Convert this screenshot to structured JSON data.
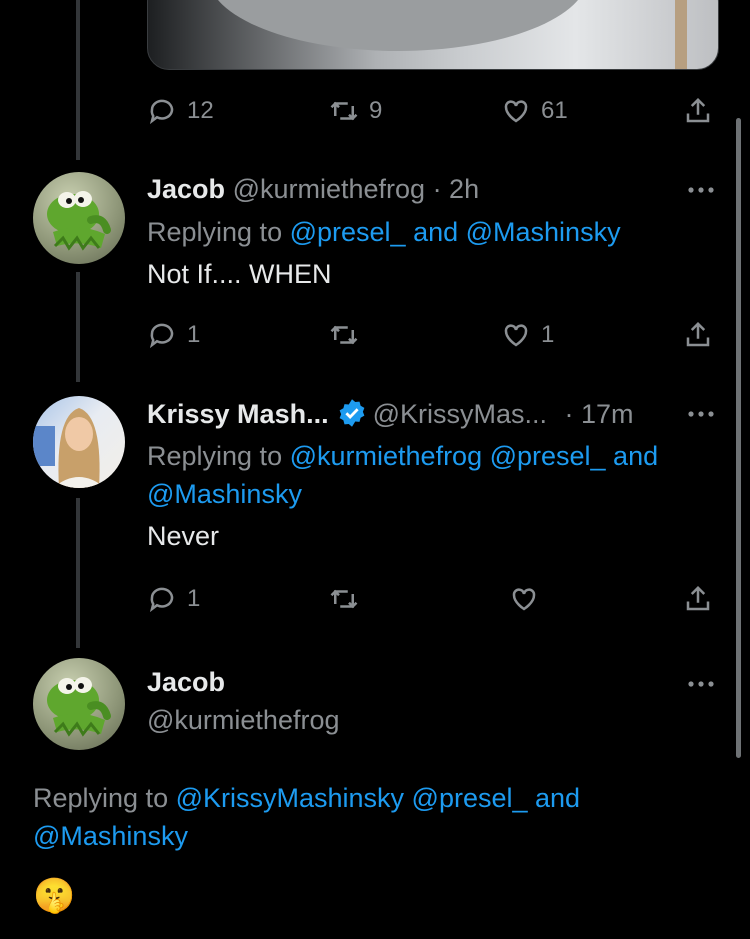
{
  "top_tweet": {
    "actions": {
      "replies": "12",
      "retweets": "9",
      "likes": "61"
    }
  },
  "reply1": {
    "name": "Jacob",
    "handle": "@kurmiethefrog",
    "time": "· 2h",
    "replying_prefix": "Replying to",
    "replying_mentions": "@presel_ and @Mashinsky",
    "text": "Not If.... WHEN",
    "actions": {
      "replies": "1",
      "likes": "1"
    }
  },
  "reply2": {
    "name": "Krissy Mash...",
    "handle": "@KrissyMas...",
    "time": "· 17m",
    "replying_prefix": "Replying to",
    "replying_mentions_line1": "@kurmiethefrog @presel_ and",
    "replying_mentions_line2": "@Mashinsky",
    "text": "Never",
    "actions": {
      "replies": "1"
    }
  },
  "main_tweet": {
    "name": "Jacob",
    "handle": "@kurmiethefrog",
    "replying_prefix": "Replying to",
    "replying_mentions_line1": "@KrissyMashinsky @presel_ and",
    "replying_mentions_line2": "@Mashinsky",
    "emoji": "🤫"
  },
  "colors": {
    "link": "#1d9bf0",
    "muted": "#8b8f93",
    "text": "#e7e9ea",
    "background": "#000000"
  }
}
